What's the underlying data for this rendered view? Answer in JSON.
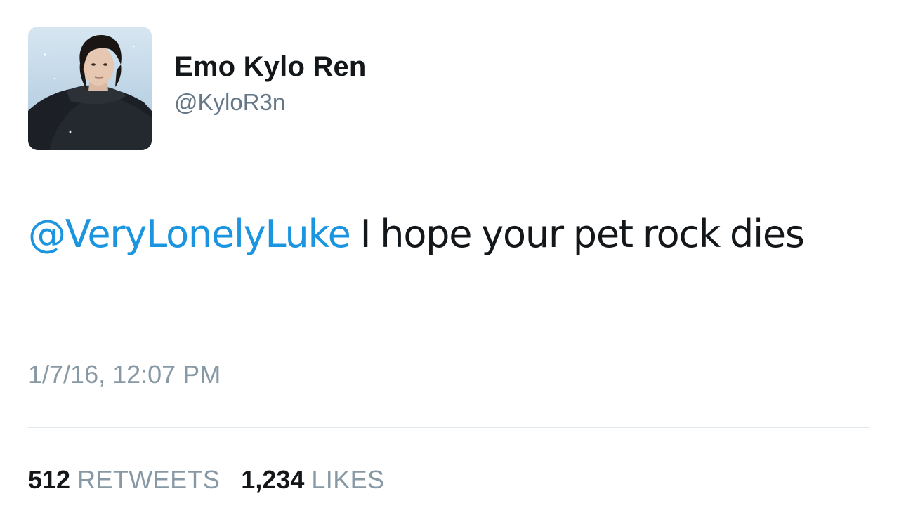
{
  "tweet": {
    "author": {
      "display_name": "Emo Kylo Ren",
      "handle": "@KyloR3n",
      "avatar_icon": "profile-photo"
    },
    "text": {
      "mention": "@VeryLonelyLuke",
      "body": " I hope your pet rock dies"
    },
    "timestamp": "1/7/16, 12:07 PM",
    "stats": {
      "retweets_count": "512",
      "retweets_label": "RETWEETS",
      "likes_count": "1,234",
      "likes_label": "LIKES"
    }
  },
  "colors": {
    "mention": "#1b95e0",
    "secondary_text": "#8899a6",
    "handle": "#657786",
    "divider": "#e1e8ed"
  }
}
